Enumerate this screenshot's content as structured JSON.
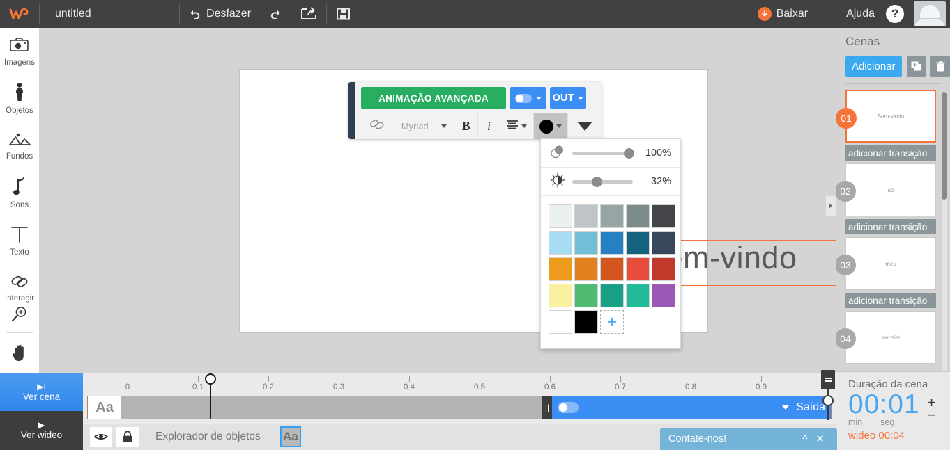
{
  "topbar": {
    "logo": "w-logo-icon",
    "doc_title": "untitled",
    "undo_label": "Desfazer",
    "redo_icon": "redo-icon",
    "export_icon": "export-icon",
    "save_icon": "save-icon",
    "download_label": "Baixar",
    "help_label": "Ajuda",
    "help_icon": "question-mark-icon",
    "avatar": "user-avatar"
  },
  "rail": {
    "items": [
      {
        "label": "Imagens",
        "icon": "camera-icon"
      },
      {
        "label": "Objetos",
        "icon": "person-icon"
      },
      {
        "label": "Fundos",
        "icon": "landscape-icon"
      },
      {
        "label": "Sons",
        "icon": "music-note-icon"
      },
      {
        "label": "Texto",
        "icon": "text-t-icon"
      },
      {
        "label": "Interagir",
        "icon": "chain-link-icon"
      }
    ],
    "hand_icon": "hand-icon",
    "view_scene": {
      "label": "Ver cena",
      "glyph": "▶I"
    },
    "view_video": {
      "label": "Ver wideo",
      "glyph": "▶"
    }
  },
  "canvas": {
    "text_object": "Bem-vindo"
  },
  "toolbar": {
    "advanced_animation": "ANIMAÇÃO AVANÇADA",
    "toggle_icon": "animation-toggle",
    "out_label": "OUT",
    "link_icon": "link-icon",
    "font_name": "Myriad",
    "bold_label": "B",
    "italic_label": "i",
    "align_icon": "align-icon",
    "color_icon": "color-dot-icon",
    "more_icon": "chevron-down-icon"
  },
  "color_picker": {
    "opacity": {
      "icon": "opacity-icon",
      "value": "100%",
      "percent": 100
    },
    "brightness": {
      "icon": "brightness-icon",
      "value": "32%",
      "percent": 32
    },
    "swatches": [
      [
        "#eaf1f1",
        "#bec4c8",
        "#97a5a5",
        "#7c8c8c",
        "#434548"
      ],
      [
        "#a7dcf5",
        "#72bdd8",
        "#2581c4",
        "#13637f",
        "#37475c"
      ],
      [
        "#ee9c1d",
        "#e2801e",
        "#d3561f",
        "#e74c3c",
        "#c0392b"
      ],
      [
        "#f9f0a0",
        "#4fbc71",
        "#18a085",
        "#21bb9c",
        "#9b59b6"
      ],
      [
        "#ffffff",
        "#000000"
      ]
    ],
    "add_label": "+"
  },
  "scenes": {
    "title": "Cenas",
    "add_label": "Adicionar",
    "duplicate_icon": "duplicate-icon",
    "delete_icon": "trash-icon",
    "transition_label": "adicionar transição",
    "items": [
      {
        "num": "01",
        "text": "Bem-vindo",
        "selected": true
      },
      {
        "num": "02",
        "text": "ao",
        "selected": false
      },
      {
        "num": "03",
        "text": "meu",
        "selected": false
      },
      {
        "num": "04",
        "text": "website",
        "selected": false
      }
    ],
    "collapse_icon": "collapse-panel-icon"
  },
  "duration": {
    "title": "Duração da cena",
    "value": "00:01",
    "unit_min": "min",
    "unit_sec": "seg",
    "total": "wideo 00:04",
    "plus": "+",
    "minus": "−"
  },
  "timeline": {
    "ticks": [
      "0",
      "0.1",
      "0.2",
      "0.3",
      "0.4",
      "0.5",
      "0.6",
      "0.7",
      "0.8",
      "0.9"
    ],
    "track_label": "Aa",
    "out_label": "Saída",
    "grip_icon": "drag-grip-icon",
    "toggle_icon": "track-toggle",
    "playhead_icon": "playhead-knob"
  },
  "bottombar": {
    "eye_icon": "eye-icon",
    "lock_icon": "lock-icon",
    "explorer_label": "Explorador de objetos",
    "object_label": "Aa"
  },
  "chat": {
    "label": "Contate-nos!",
    "collapse_icon": "chevron-up-icon",
    "close_icon": "close-icon"
  },
  "colors": {
    "accent_orange": "#f4743b",
    "accent_blue": "#3b8ef3",
    "green": "#27ae60",
    "dark_chrome": "#414141"
  }
}
